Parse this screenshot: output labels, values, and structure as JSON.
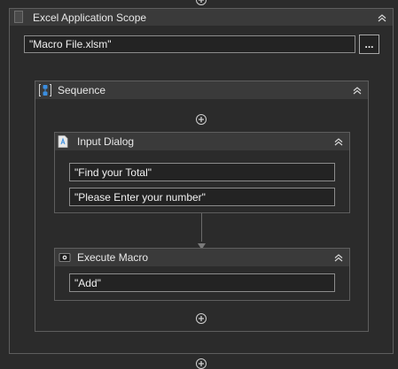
{
  "excel_scope": {
    "title": "Excel Application Scope",
    "file_value": "\"Macro File.xlsm\"",
    "browse_label": "..."
  },
  "sequence": {
    "title": "Sequence"
  },
  "input_dialog": {
    "title": "Input Dialog",
    "title_value": "\"Find your Total\"",
    "label_value": "\"Please Enter your number\""
  },
  "execute_macro": {
    "title": "Execute Macro",
    "macro_name_value": "\"Add\""
  },
  "colors": {
    "canvas": "#2b2b2b",
    "header": "#3a3a3a",
    "border": "#5e5e5e",
    "sequence_icon_blue": "#3b8ee0"
  },
  "icons": [
    "excel-icon",
    "sequence-icon",
    "input-dialog-icon",
    "execute-macro-icon",
    "collapse-chevron-icon",
    "add-activity-icon"
  ]
}
